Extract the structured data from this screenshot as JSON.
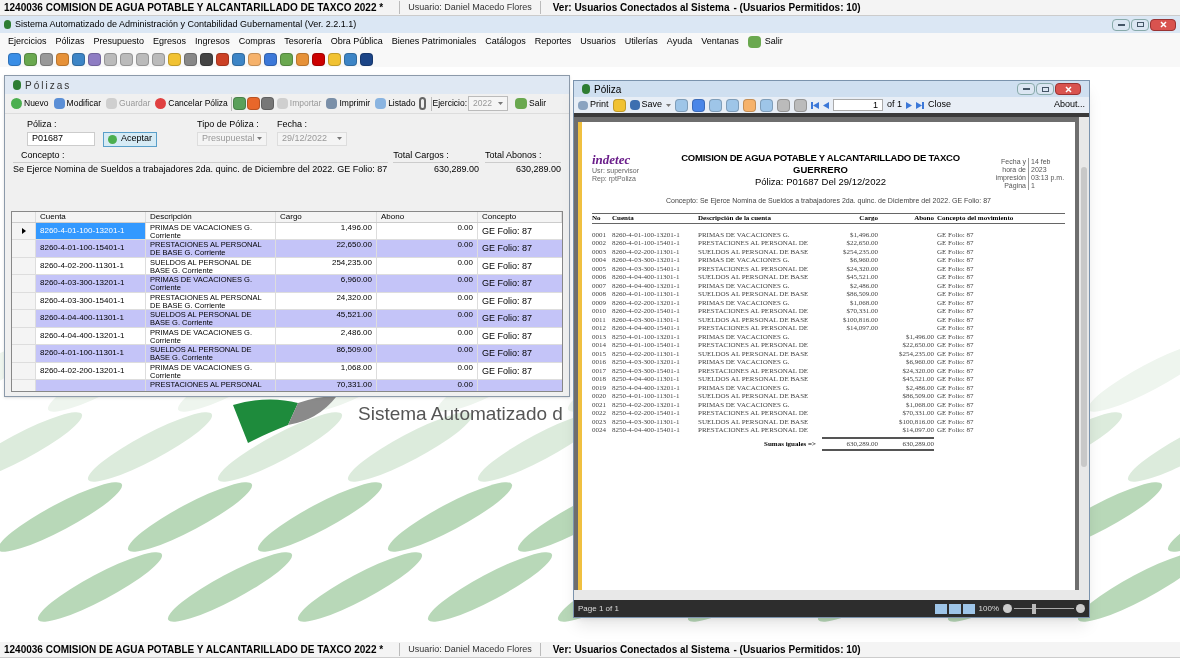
{
  "top_bar": {
    "company": "1240036 COMISION DE AGUA POTABLE Y ALCANTARILLADO DE TAXCO  2022  *",
    "user": "Usuario: Daniel Macedo Flores",
    "connected": "Ver: Usuarios Conectados al Sistema",
    "allowed": "- (Usuarios Permitidos: 10)"
  },
  "app_title": "Sistema Automatizado de Administración y Contabilidad Gubernamental  (Ver. 2.2.1.1)",
  "menu": [
    "Ejercicios",
    "Pólizas",
    "Presupuesto",
    "Egresos",
    "Ingresos",
    "Compras",
    "Tesorería",
    "Obra Pública",
    "Bienes Patrimoniales",
    "Catálogos",
    "Reportes",
    "Usuarios",
    "Utilerías",
    "Ayuda",
    "Ventanas",
    "Salir"
  ],
  "polizas_window": {
    "title": "Pólizas",
    "toolbar": [
      {
        "label": "Nuevo",
        "disabled": false
      },
      {
        "label": "Modificar",
        "disabled": false
      },
      {
        "label": "Guardar",
        "disabled": true
      },
      {
        "label": "Cancelar Póliza",
        "disabled": false
      },
      {
        "label": "Importar",
        "disabled": true
      },
      {
        "label": "Imprimir",
        "disabled": false
      },
      {
        "label": "Listado",
        "disabled": false
      }
    ],
    "ejercicio_label": "Ejercicio:",
    "ejercicio_value": "2022",
    "salir": "Salir",
    "poliza_label": "Póliza :",
    "poliza_value": "P01687",
    "aceptar": "Aceptar",
    "tipo_label": "Tipo de Póliza :",
    "tipo_value": "Presupuestal",
    "fecha_label": "Fecha :",
    "fecha_value": "29/12/2022",
    "concepto_label": "Concepto :",
    "concepto_value": "Se Ejerce Nomina de Sueldos a trabajadores 2da. quinc. de Diciembre del 2022. GE Folio: 87",
    "total_cargos_label": "Total Cargos :",
    "total_cargos": "630,289.00",
    "total_abonos_label": "Total Abonos :",
    "total_abonos": "630,289.00",
    "columns": [
      "Cuenta",
      "Descripción",
      "Cargo",
      "Abono",
      "Concepto"
    ],
    "rows": [
      {
        "cuenta": "8260-4-01-100-13201-1",
        "descripcion": "PRIMAS DE VACACIONES G. Corriente",
        "cargo": "1,496.00",
        "abono": "0.00",
        "concepto": "GE Folio: 87",
        "selected": true
      },
      {
        "cuenta": "8260-4-01-100-15401-1",
        "descripcion": "PRESTACIONES AL PERSONAL DE BASE G. Corriente",
        "cargo": "22,650.00",
        "abono": "0.00",
        "concepto": "GE Folio: 87",
        "selected": false
      },
      {
        "cuenta": "8260-4-02-200-11301-1",
        "descripcion": "SUELDOS AL PERSONAL DE BASE G. Corriente",
        "cargo": "254,235.00",
        "abono": "0.00",
        "concepto": "GE Folio: 87",
        "selected": false
      },
      {
        "cuenta": "8260-4-03-300-13201-1",
        "descripcion": "PRIMAS DE VACACIONES G. Corriente",
        "cargo": "6,960.00",
        "abono": "0.00",
        "concepto": "GE Folio: 87",
        "selected": false
      },
      {
        "cuenta": "8260-4-03-300-15401-1",
        "descripcion": "PRESTACIONES AL PERSONAL DE BASE G. Corriente",
        "cargo": "24,320.00",
        "abono": "0.00",
        "concepto": "GE Folio: 87",
        "selected": false
      },
      {
        "cuenta": "8260-4-04-400-11301-1",
        "descripcion": "SUELDOS AL PERSONAL DE BASE G. Corriente",
        "cargo": "45,521.00",
        "abono": "0.00",
        "concepto": "GE Folio: 87",
        "selected": false
      },
      {
        "cuenta": "8260-4-04-400-13201-1",
        "descripcion": "PRIMAS DE VACACIONES G. Corriente",
        "cargo": "2,486.00",
        "abono": "0.00",
        "concepto": "GE Folio: 87",
        "selected": false
      },
      {
        "cuenta": "8260-4-01-100-11301-1",
        "descripcion": "SUELDOS AL PERSONAL DE BASE G. Corriente",
        "cargo": "86,509.00",
        "abono": "0.00",
        "concepto": "GE Folio: 87",
        "selected": false
      },
      {
        "cuenta": "8260-4-02-200-13201-1",
        "descripcion": "PRIMAS DE VACACIONES G. Corriente",
        "cargo": "1,068.00",
        "abono": "0.00",
        "concepto": "GE Folio: 87",
        "selected": false
      },
      {
        "descripcion": "PRESTACIONES AL PERSONAL",
        "cargo": "70,331.00",
        "abono": "0.00",
        "selected": false
      }
    ]
  },
  "report_window": {
    "title": "Póliza",
    "print": "Print",
    "save": "Save",
    "page_input": "1",
    "page_of": "of 1",
    "close": "Close",
    "about": "About...",
    "logo": "indetec",
    "user": "Usr: supervisor",
    "rep": "Rep: rptPoliza",
    "org": "COMISION DE AGUA POTABLE Y ALCANTARILLADO DE TAXCO",
    "org2": "GUERRERO",
    "subtitle": "Póliza:  P01687  Del 29/12/2022",
    "fecha_label": "Fecha y hora de impresión",
    "fecha_value": "14 feb 2023 03:13 p.m.",
    "pagina_label": "Página",
    "pagina_value": "1",
    "concepto": "Concepto: Se Ejerce Nomina de Sueldos a trabajadores 2da. quinc. de Diciembre del 2022. GE Folio: 87",
    "columns": [
      "No",
      "Cuenta",
      "Descripción de la cuenta",
      "Cargo",
      "Abono",
      "Concepto del movimiento"
    ],
    "rows": [
      [
        "0001",
        "8260-4-01-100-13201-1",
        "PRIMAS DE VACACIONES G.",
        "$1,496.00",
        "",
        "GE Folio: 87"
      ],
      [
        "0002",
        "8260-4-01-100-15401-1",
        "PRESTACIONES AL PERSONAL DE",
        "$22,650.00",
        "",
        "GE Folio: 87"
      ],
      [
        "0003",
        "8260-4-02-200-11301-1",
        "SUELDOS AL PERSONAL DE BASE",
        "$254,235.00",
        "",
        "GE Folio: 87"
      ],
      [
        "0004",
        "8260-4-03-300-13201-1",
        "PRIMAS DE VACACIONES G.",
        "$6,960.00",
        "",
        "GE Folio: 87"
      ],
      [
        "0005",
        "8260-4-03-300-15401-1",
        "PRESTACIONES AL PERSONAL DE",
        "$24,320.00",
        "",
        "GE Folio: 87"
      ],
      [
        "0006",
        "8260-4-04-400-11301-1",
        "SUELDOS AL PERSONAL DE BASE",
        "$45,521.00",
        "",
        "GE Folio: 87"
      ],
      [
        "0007",
        "8260-4-04-400-13201-1",
        "PRIMAS DE VACACIONES G.",
        "$2,486.00",
        "",
        "GE Folio: 87"
      ],
      [
        "0008",
        "8260-4-01-100-11301-1",
        "SUELDOS AL PERSONAL DE BASE",
        "$86,509.00",
        "",
        "GE Folio: 87"
      ],
      [
        "0009",
        "8260-4-02-200-13201-1",
        "PRIMAS DE VACACIONES G.",
        "$1,068.00",
        "",
        "GE Folio: 87"
      ],
      [
        "0010",
        "8260-4-02-200-15401-1",
        "PRESTACIONES AL PERSONAL DE",
        "$70,331.00",
        "",
        "GE Folio: 87"
      ],
      [
        "0011",
        "8260-4-03-300-11301-1",
        "SUELDOS AL PERSONAL DE BASE",
        "$100,816.00",
        "",
        "GE Folio: 87"
      ],
      [
        "0012",
        "8260-4-04-400-15401-1",
        "PRESTACIONES AL PERSONAL DE",
        "$14,097.00",
        "",
        "GE Folio: 87"
      ],
      [
        "0013",
        "8250-4-01-100-13201-1",
        "PRIMAS DE VACACIONES G.",
        "",
        "$1,496.00",
        "GE Folio: 87"
      ],
      [
        "0014",
        "8250-4-01-100-15401-1",
        "PRESTACIONES AL PERSONAL DE",
        "",
        "$22,650.00",
        "GE Folio: 87"
      ],
      [
        "0015",
        "8250-4-02-200-11301-1",
        "SUELDOS AL PERSONAL DE BASE",
        "",
        "$254,235.00",
        "GE Folio: 87"
      ],
      [
        "0016",
        "8250-4-03-300-13201-1",
        "PRIMAS DE VACACIONES G.",
        "",
        "$6,960.00",
        "GE Folio: 87"
      ],
      [
        "0017",
        "8250-4-03-300-15401-1",
        "PRESTACIONES AL PERSONAL DE",
        "",
        "$24,320.00",
        "GE Folio: 87"
      ],
      [
        "0018",
        "8250-4-04-400-11301-1",
        "SUELDOS AL PERSONAL DE BASE",
        "",
        "$45,521.00",
        "GE Folio: 87"
      ],
      [
        "0019",
        "8250-4-04-400-13201-1",
        "PRIMAS DE VACACIONES G.",
        "",
        "$2,486.00",
        "GE Folio: 87"
      ],
      [
        "0020",
        "8250-4-01-100-11301-1",
        "SUELDOS AL PERSONAL DE BASE",
        "",
        "$86,509.00",
        "GE Folio: 87"
      ],
      [
        "0021",
        "8250-4-02-200-13201-1",
        "PRIMAS DE VACACIONES G.",
        "",
        "$1,068.00",
        "GE Folio: 87"
      ],
      [
        "0022",
        "8250-4-02-200-15401-1",
        "PRESTACIONES AL PERSONAL DE",
        "",
        "$70,331.00",
        "GE Folio: 87"
      ],
      [
        "0023",
        "8250-4-03-300-11301-1",
        "SUELDOS AL PERSONAL DE BASE",
        "",
        "$100,816.00",
        "GE Folio: 87"
      ],
      [
        "0024",
        "8250-4-04-400-15401-1",
        "PRESTACIONES AL PERSONAL DE",
        "",
        "$14,097.00",
        "GE Folio: 87"
      ]
    ],
    "totals_label": "Sumas iguales =>",
    "total_cargo": "630,289.00",
    "total_abono": "630,289.00",
    "status": "Page 1 of 1",
    "zoom": {
      "label": "100%",
      "level": 0.33
    }
  },
  "background_text": "Sistema Automatizado d",
  "bottom_bar": {
    "company": "1240036 COMISION DE AGUA POTABLE Y ALCANTARILLADO DE TAXCO  2022  *",
    "user": "Usuario: Daniel Macedo Flores",
    "connected": "Ver: Usuarios Conectados al Sistema",
    "allowed": "- (Usuarios Permitidos: 10)"
  }
}
